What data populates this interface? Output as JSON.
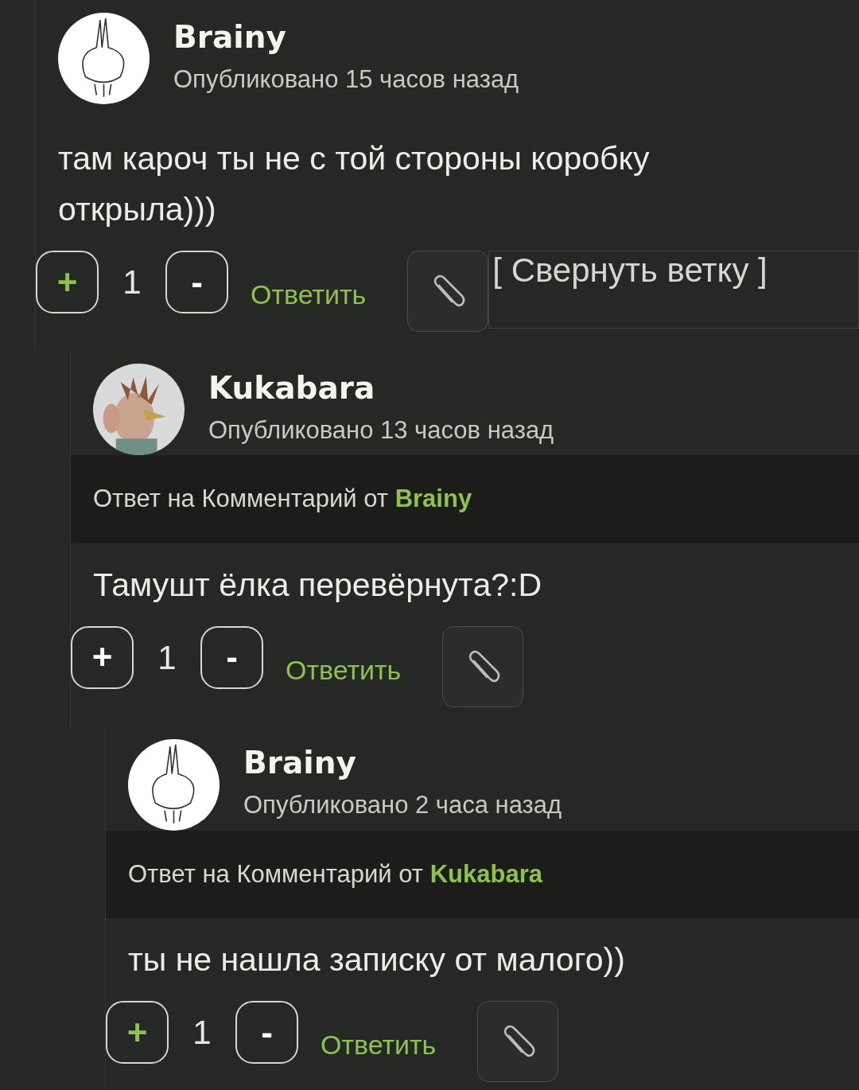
{
  "comments": [
    {
      "author": "Brainy",
      "posted": "Опубликовано 15 часов назад",
      "text": "там кароч ты не с той стороны коробку открыла)))",
      "score": "1",
      "upvoted": true,
      "plus": "+",
      "minus": "-",
      "reply_label": "Ответить",
      "collapse_label": "[ Свернуть ветку ]",
      "children": [
        {
          "author": "Kukabara",
          "posted": "Опубликовано 13 часов назад",
          "reply_to": "Ответ на Комментарий от **Brainy**",
          "text": "Тамушт ёлка перевёрнута?:D",
          "score": "1",
          "upvoted": false,
          "plus": "+",
          "minus": "-",
          "reply_label": "Ответить",
          "children": [
            {
              "author": "Brainy",
              "posted": "Опубликовано 2 часа назад",
              "reply_to": "Ответ на Комментарий от **Kukabara**",
              "text": "ты не нашла записку от малого))",
              "score": "1",
              "upvoted": true,
              "plus": "+",
              "minus": "-",
              "reply_label": "Ответить"
            }
          ]
        }
      ]
    }
  ]
}
